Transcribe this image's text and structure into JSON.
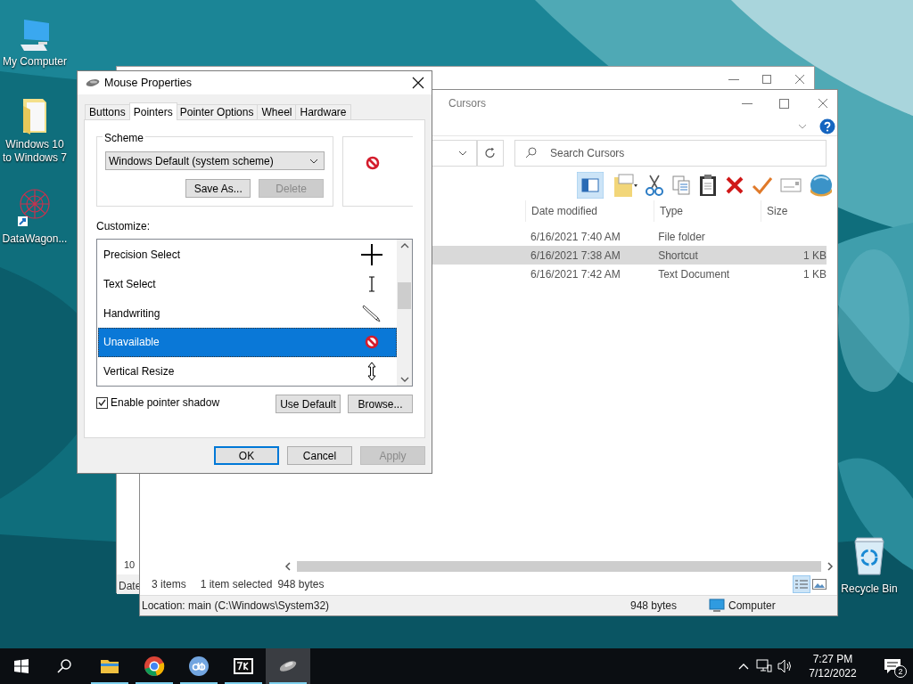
{
  "desktop_icons": [
    {
      "kind": "computer",
      "label": "My Computer"
    },
    {
      "kind": "folder",
      "label": "Windows 10 to Windows 7"
    },
    {
      "kind": "network",
      "label": "DataWagon..."
    }
  ],
  "back_window": {
    "column_1_cell": "10",
    "column_1_header": "Date"
  },
  "explorer": {
    "title": "Cursors",
    "search": {
      "placeholder": "Search Cursors"
    },
    "columns": [
      "Date modified",
      "Type",
      "Size"
    ],
    "rows": [
      {
        "date": "6/16/2021 7:40 AM",
        "type": "File folder",
        "selected": false
      },
      {
        "date": "6/16/2021 7:38 AM",
        "type": "Shortcut",
        "size": "1 KB",
        "selected": true
      },
      {
        "date": "6/16/2021 7:42 AM",
        "type": "Text Document",
        "size": "1 KB",
        "selected": false
      }
    ],
    "status": {
      "items": "3 items",
      "selection": "1 item selected",
      "bytes": "948 bytes"
    },
    "location_bar": {
      "location": "Location: main (C:\\Windows\\System32)",
      "size": "948 bytes",
      "zone": "Computer"
    }
  },
  "dialog": {
    "title": "Mouse Properties",
    "tabs": [
      {
        "label": "Buttons",
        "selected": false
      },
      {
        "label": "Pointers",
        "selected": true
      },
      {
        "label": "Pointer Options",
        "selected": false
      },
      {
        "label": "Wheel",
        "selected": false
      },
      {
        "label": "Hardware",
        "selected": false
      }
    ],
    "scheme": {
      "legend": "Scheme",
      "value": "Windows Default (system scheme)",
      "buttons": [
        {
          "label": "Save As...",
          "disabled": false
        },
        {
          "label": "Delete",
          "disabled": true
        }
      ]
    },
    "customize_label": "Customize:",
    "pointers": [
      {
        "label": "Precision Select",
        "kind": "cross",
        "selected": false
      },
      {
        "label": "Text Select",
        "kind": "beam",
        "selected": false
      },
      {
        "label": "Handwriting",
        "kind": "pen",
        "selected": false
      },
      {
        "label": "Unavailable",
        "kind": "no",
        "selected": true
      },
      {
        "label": "Vertical Resize",
        "kind": "vresize",
        "selected": false
      }
    ],
    "shadow": {
      "label": "Enable pointer shadow",
      "checked": true
    },
    "list_buttons": [
      {
        "label": "Use Default",
        "disabled": false
      },
      {
        "label": "Browse...",
        "disabled": false
      }
    ],
    "buttons": [
      {
        "label": "OK",
        "disabled": false,
        "default": true
      },
      {
        "label": "Cancel",
        "disabled": false,
        "default": false
      },
      {
        "label": "Apply",
        "disabled": true,
        "default": false
      }
    ]
  },
  "recycle_bin": {
    "label": "Recycle Bin"
  },
  "taskbar": {
    "apps": [
      {
        "kind": "explorer",
        "active": false
      },
      {
        "kind": "chrome",
        "active": false
      },
      {
        "kind": "qbittorrent",
        "active": false
      },
      {
        "kind": "sevenzip",
        "active": false
      },
      {
        "kind": "mouse",
        "active": true
      }
    ],
    "time": "7:27 PM",
    "date": "7/12/2022",
    "notifications": "2"
  }
}
